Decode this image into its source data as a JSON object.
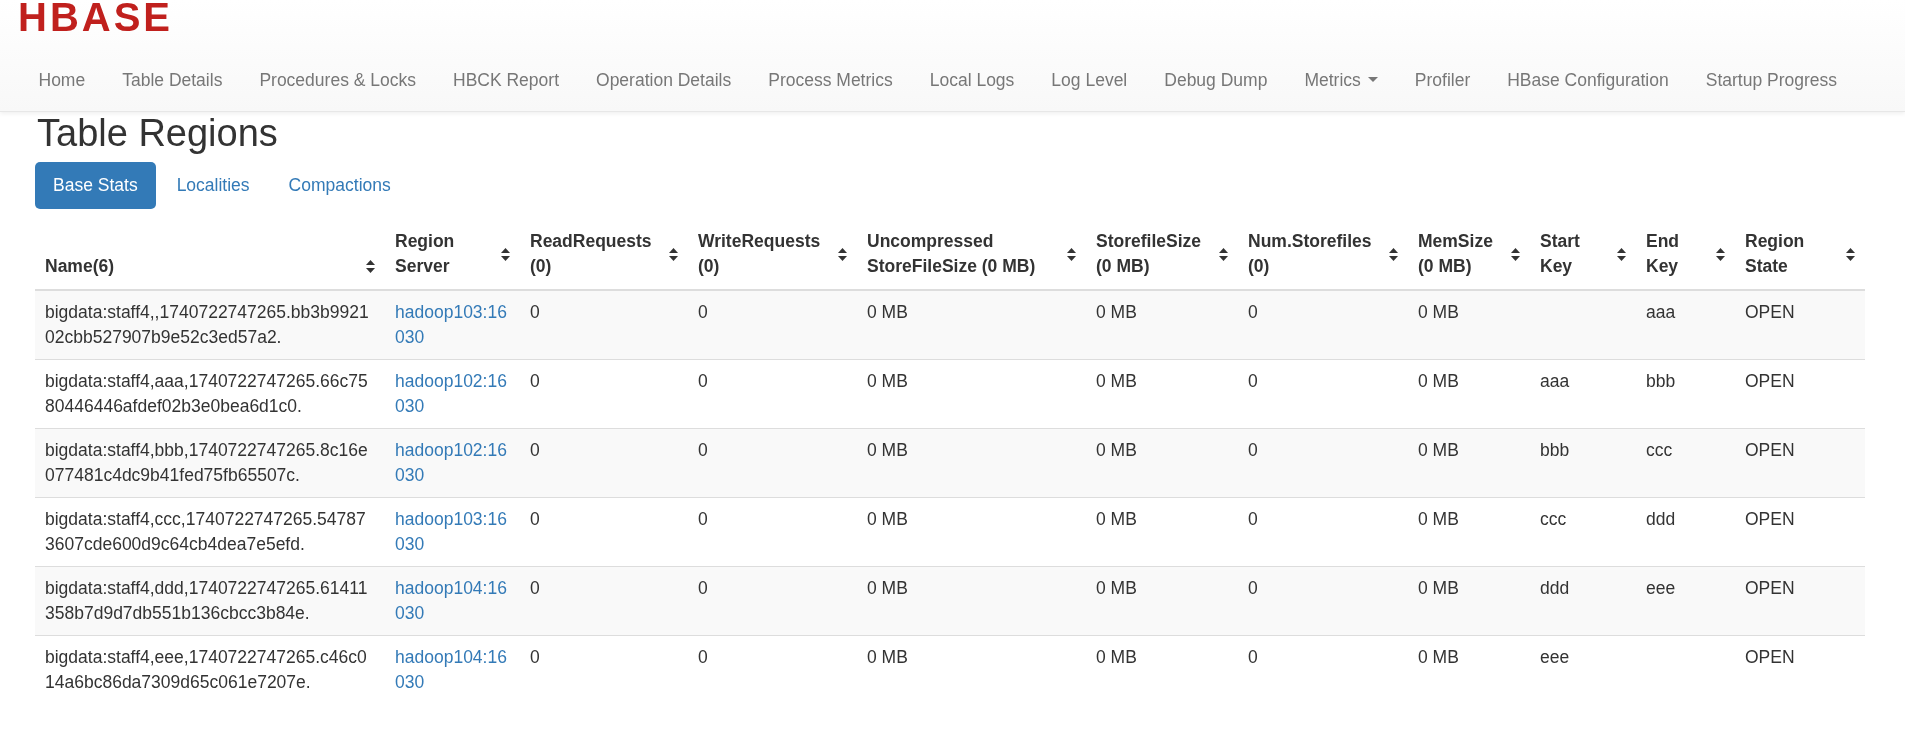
{
  "logo": "HBASE",
  "nav": [
    {
      "label": "Home",
      "kind": "link"
    },
    {
      "label": "Table Details",
      "kind": "link"
    },
    {
      "label": "Procedures & Locks",
      "kind": "link"
    },
    {
      "label": "HBCK Report",
      "kind": "link"
    },
    {
      "label": "Operation Details",
      "kind": "link"
    },
    {
      "label": "Process Metrics",
      "kind": "link"
    },
    {
      "label": "Local Logs",
      "kind": "link"
    },
    {
      "label": "Log Level",
      "kind": "link"
    },
    {
      "label": "Debug Dump",
      "kind": "link"
    },
    {
      "label": "Metrics",
      "kind": "dropdown"
    },
    {
      "label": "Profiler",
      "kind": "link"
    },
    {
      "label": "HBase Configuration",
      "kind": "link"
    },
    {
      "label": "Startup Progress",
      "kind": "link"
    }
  ],
  "heading": "Table Regions",
  "tabs": [
    {
      "label": "Base Stats",
      "selected": true
    },
    {
      "label": "Localities",
      "selected": false
    },
    {
      "label": "Compactions",
      "selected": false
    }
  ],
  "table": {
    "columns": [
      "Name(6)",
      "Region Server",
      "ReadRequests (0)",
      "WriteRequests (0)",
      "Uncompressed StoreFileSize (0 MB)",
      "StorefileSize (0 MB)",
      "Num.Storefiles (0)",
      "MemSize (0 MB)",
      "Start Key",
      "End Key",
      "Region State"
    ],
    "rows": [
      [
        "bigdata:staff4,,1740722747265.bb3b992102cbb527907b9e52c3ed57a2.",
        "hadoop103:16030",
        "0",
        "0",
        "0 MB",
        "0 MB",
        "0",
        "0 MB",
        null,
        "aaa",
        "OPEN"
      ],
      [
        "bigdata:staff4,aaa,1740722747265.66c7580446446afdef02b3e0bea6d1c0.",
        "hadoop102:16030",
        "0",
        "0",
        "0 MB",
        "0 MB",
        "0",
        "0 MB",
        "aaa",
        "bbb",
        "OPEN"
      ],
      [
        "bigdata:staff4,bbb,1740722747265.8c16e077481c4dc9b41fed75fb65507c.",
        "hadoop102:16030",
        "0",
        "0",
        "0 MB",
        "0 MB",
        "0",
        "0 MB",
        "bbb",
        "ccc",
        "OPEN"
      ],
      [
        "bigdata:staff4,ccc,1740722747265.547873607cde600d9c64cb4dea7e5efd.",
        "hadoop103:16030",
        "0",
        "0",
        "0 MB",
        "0 MB",
        "0",
        "0 MB",
        "ccc",
        "ddd",
        "OPEN"
      ],
      [
        "bigdata:staff4,ddd,1740722747265.61411358b7d9d7db551b136cbcc3b84e.",
        "hadoop104:16030",
        "0",
        "0",
        "0 MB",
        "0 MB",
        "0",
        "0 MB",
        "ddd",
        "eee",
        "OPEN"
      ],
      [
        "bigdata:staff4,eee,1740722747265.c46c014a6bc86da7309d65c061e7207e.",
        "hadoop104:16030",
        "0",
        "0",
        "0 MB",
        "0 MB",
        "0",
        "0 MB",
        "eee",
        null,
        "OPEN"
      ]
    ]
  }
}
